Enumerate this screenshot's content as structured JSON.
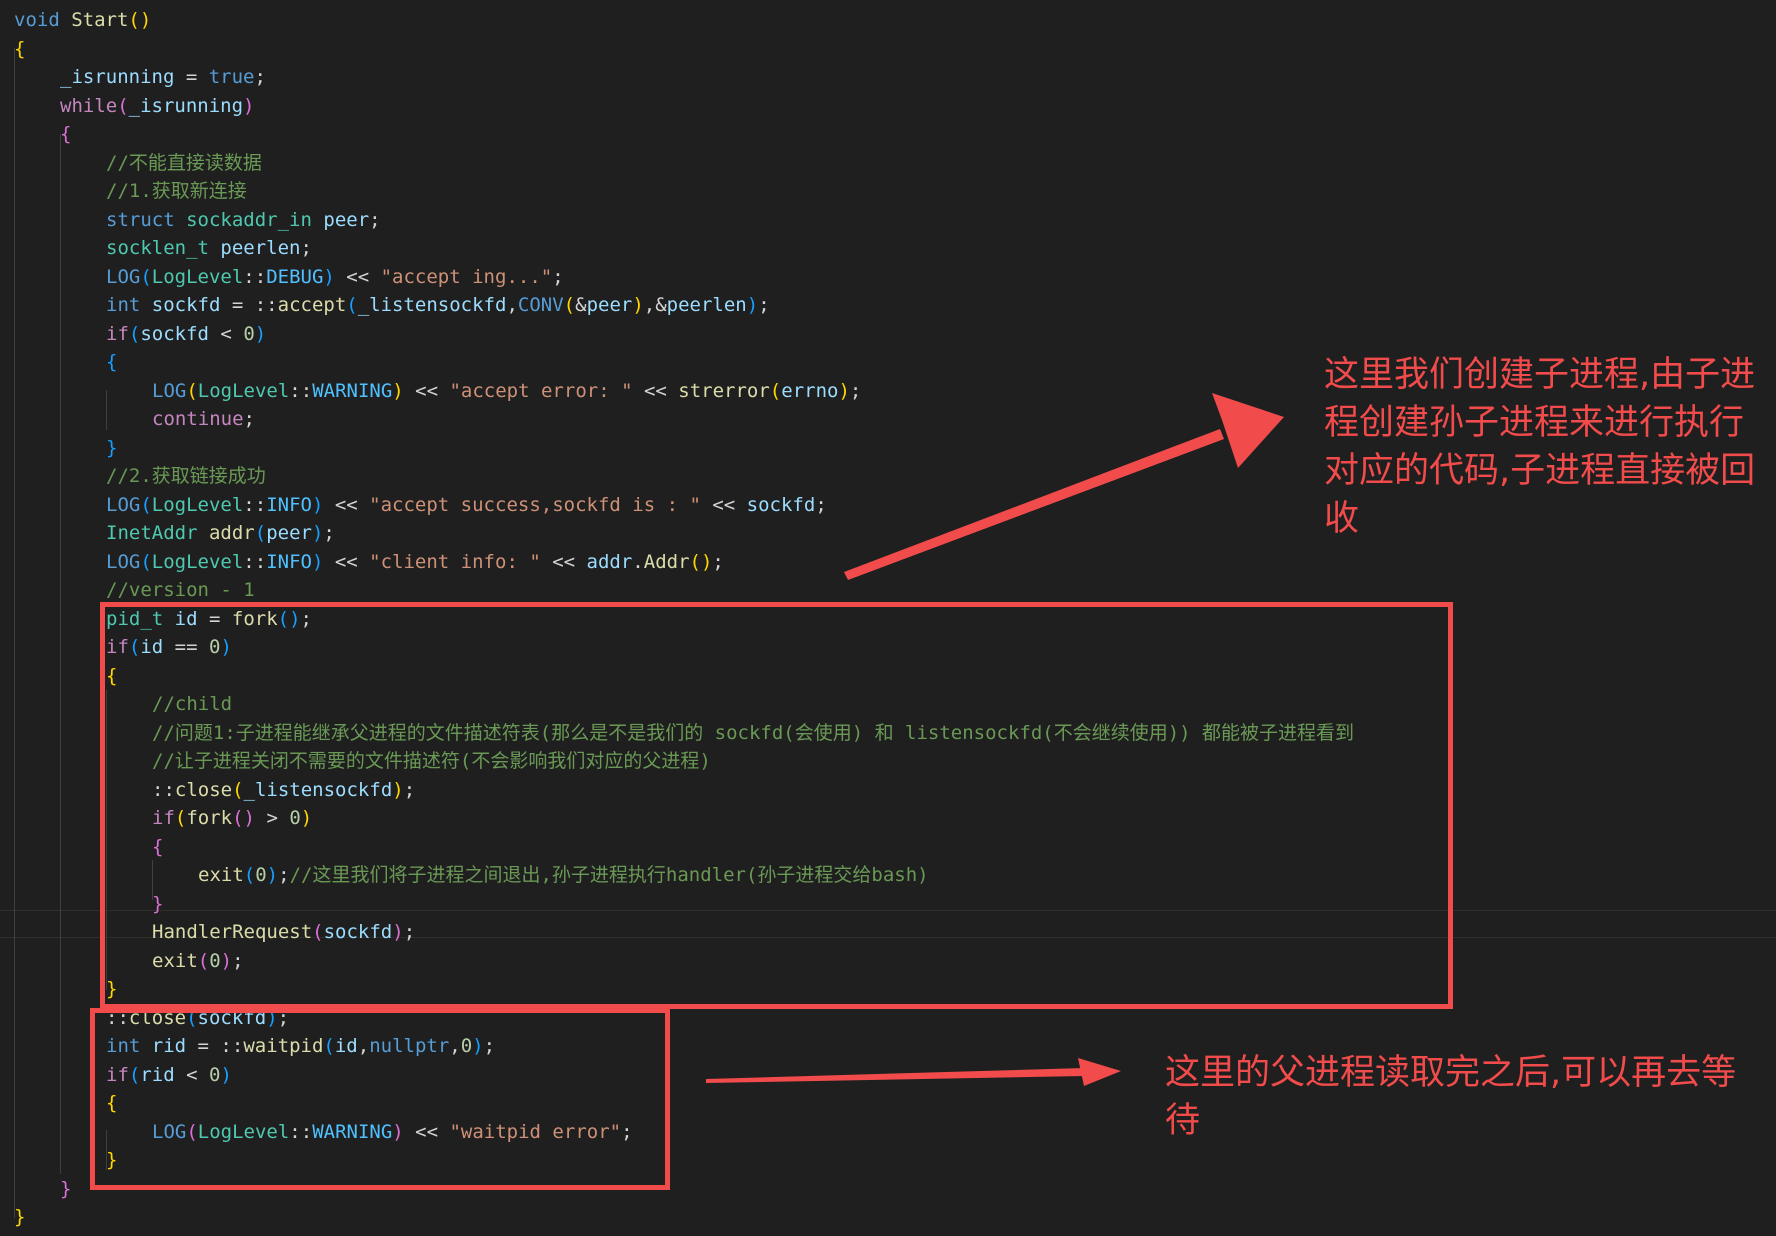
{
  "code_lines": [
    [
      [
        "void",
        "keyword"
      ],
      [
        " ",
        "punct"
      ],
      [
        "Start",
        "function"
      ],
      [
        "()",
        "bracket1"
      ]
    ],
    [
      [
        "{",
        "bracket1"
      ]
    ],
    [
      [
        "_isrunning",
        "variable"
      ],
      [
        " = ",
        "punct"
      ],
      [
        "true",
        "keyword"
      ],
      [
        ";",
        "punct"
      ]
    ],
    [
      [
        "while",
        "control"
      ],
      [
        "(",
        "bracket2"
      ],
      [
        "_isrunning",
        "variable"
      ],
      [
        ")",
        "bracket2"
      ]
    ],
    [
      [
        "{",
        "bracket2"
      ]
    ],
    [
      [
        "//不能直接读数据",
        "comment"
      ]
    ],
    [
      [
        "//1.获取新连接",
        "comment"
      ]
    ],
    [
      [
        "struct",
        "keyword"
      ],
      [
        " ",
        "punct"
      ],
      [
        "sockaddr_in",
        "type"
      ],
      [
        " ",
        "punct"
      ],
      [
        "peer",
        "variable"
      ],
      [
        ";",
        "punct"
      ]
    ],
    [
      [
        "socklen_t",
        "type"
      ],
      [
        " ",
        "punct"
      ],
      [
        "peerlen",
        "variable"
      ],
      [
        ";",
        "punct"
      ]
    ],
    [
      [
        "LOG",
        "macro"
      ],
      [
        "(",
        "bracket3"
      ],
      [
        "LogLevel",
        "type"
      ],
      [
        "::",
        "punct"
      ],
      [
        "DEBUG",
        "constant"
      ],
      [
        ")",
        "bracket3"
      ],
      [
        " << ",
        "punct"
      ],
      [
        "\"accept ing...\"",
        "string"
      ],
      [
        ";",
        "punct"
      ]
    ],
    [
      [
        "int",
        "keyword"
      ],
      [
        " ",
        "punct"
      ],
      [
        "sockfd",
        "variable"
      ],
      [
        " = ::",
        "punct"
      ],
      [
        "accept",
        "function"
      ],
      [
        "(",
        "bracket3"
      ],
      [
        "_listensockfd",
        "variable"
      ],
      [
        ",",
        "punct"
      ],
      [
        "CONV",
        "macro"
      ],
      [
        "(",
        "bracket1"
      ],
      [
        "&",
        "punct"
      ],
      [
        "peer",
        "variable"
      ],
      [
        ")",
        "bracket1"
      ],
      [
        ",&",
        "punct"
      ],
      [
        "peerlen",
        "variable"
      ],
      [
        ")",
        "bracket3"
      ],
      [
        ";",
        "punct"
      ]
    ],
    [
      [
        "if",
        "control"
      ],
      [
        "(",
        "bracket3"
      ],
      [
        "sockfd",
        "variable"
      ],
      [
        " < ",
        "punct"
      ],
      [
        "0",
        "number"
      ],
      [
        ")",
        "bracket3"
      ]
    ],
    [
      [
        "{",
        "bracket3"
      ]
    ],
    [
      [
        "LOG",
        "macro"
      ],
      [
        "(",
        "bracket1"
      ],
      [
        "LogLevel",
        "type"
      ],
      [
        "::",
        "punct"
      ],
      [
        "WARNING",
        "constant"
      ],
      [
        ")",
        "bracket1"
      ],
      [
        " << ",
        "punct"
      ],
      [
        "\"accept error: \"",
        "string"
      ],
      [
        " << ",
        "punct"
      ],
      [
        "strerror",
        "function"
      ],
      [
        "(",
        "bracket1"
      ],
      [
        "errno",
        "variable"
      ],
      [
        ")",
        "bracket1"
      ],
      [
        ";",
        "punct"
      ]
    ],
    [
      [
        "continue",
        "control"
      ],
      [
        ";",
        "punct"
      ]
    ],
    [
      [
        "}",
        "bracket3"
      ]
    ],
    [
      [
        "//2.获取链接成功",
        "comment"
      ]
    ],
    [
      [
        "LOG",
        "macro"
      ],
      [
        "(",
        "bracket3"
      ],
      [
        "LogLevel",
        "type"
      ],
      [
        "::",
        "punct"
      ],
      [
        "INFO",
        "constant"
      ],
      [
        ")",
        "bracket3"
      ],
      [
        " << ",
        "punct"
      ],
      [
        "\"accept success,sockfd is : \"",
        "string"
      ],
      [
        " << ",
        "punct"
      ],
      [
        "sockfd",
        "variable"
      ],
      [
        ";",
        "punct"
      ]
    ],
    [
      [
        "InetAddr",
        "type"
      ],
      [
        " ",
        "punct"
      ],
      [
        "addr",
        "function"
      ],
      [
        "(",
        "bracket3"
      ],
      [
        "peer",
        "variable"
      ],
      [
        ")",
        "bracket3"
      ],
      [
        ";",
        "punct"
      ]
    ],
    [
      [
        "LOG",
        "macro"
      ],
      [
        "(",
        "bracket3"
      ],
      [
        "LogLevel",
        "type"
      ],
      [
        "::",
        "punct"
      ],
      [
        "INFO",
        "constant"
      ],
      [
        ")",
        "bracket3"
      ],
      [
        " << ",
        "punct"
      ],
      [
        "\"client info: \"",
        "string"
      ],
      [
        " << ",
        "punct"
      ],
      [
        "addr",
        "variable"
      ],
      [
        ".",
        "punct"
      ],
      [
        "Addr",
        "function"
      ],
      [
        "()",
        "bracket1"
      ],
      [
        ";",
        "punct"
      ]
    ],
    [
      [
        "//version - 1",
        "comment"
      ]
    ],
    [
      [
        "pid_t",
        "type"
      ],
      [
        " ",
        "punct"
      ],
      [
        "id",
        "variable"
      ],
      [
        " = ",
        "punct"
      ],
      [
        "fork",
        "function"
      ],
      [
        "()",
        "bracket3"
      ],
      [
        ";",
        "punct"
      ]
    ],
    [
      [
        "if",
        "control"
      ],
      [
        "(",
        "bracket3"
      ],
      [
        "id",
        "variable"
      ],
      [
        " == ",
        "punct"
      ],
      [
        "0",
        "number"
      ],
      [
        ")",
        "bracket3"
      ]
    ],
    [
      [
        "{",
        "bracket1"
      ]
    ],
    [
      [
        "//child",
        "comment"
      ]
    ],
    [
      [
        "//问题1:子进程能继承父进程的文件描述符表(那么是不是我们的 sockfd(会使用) 和 listensockfd(不会继续使用)) 都能被子进程看到",
        "comment"
      ]
    ],
    [
      [
        "//让子进程关闭不需要的文件描述符(不会影响我们对应的父进程)",
        "comment"
      ]
    ],
    [
      [
        "::",
        "punct"
      ],
      [
        "close",
        "function"
      ],
      [
        "(",
        "bracket1"
      ],
      [
        "_listensockfd",
        "variable"
      ],
      [
        ")",
        "bracket1"
      ],
      [
        ";",
        "punct"
      ]
    ],
    [
      [
        "if",
        "control"
      ],
      [
        "(",
        "bracket1"
      ],
      [
        "fork",
        "function"
      ],
      [
        "()",
        "bracket2"
      ],
      [
        " > ",
        "punct"
      ],
      [
        "0",
        "number"
      ],
      [
        ")",
        "bracket1"
      ]
    ],
    [
      [
        "{",
        "bracket2"
      ]
    ],
    [
      [
        "exit",
        "function"
      ],
      [
        "(",
        "bracket3"
      ],
      [
        "0",
        "number"
      ],
      [
        ")",
        "bracket3"
      ],
      [
        ";",
        "punct"
      ],
      [
        "//这里我们将子进程之间退出,孙子进程执行handler(孙子进程交给bash)",
        "comment"
      ]
    ],
    [
      [
        "}",
        "bracket2"
      ]
    ],
    [
      [
        "HandlerRequest",
        "function"
      ],
      [
        "(",
        "bracket2"
      ],
      [
        "sockfd",
        "variable"
      ],
      [
        ")",
        "bracket2"
      ],
      [
        ";",
        "punct"
      ]
    ],
    [
      [
        "exit",
        "function"
      ],
      [
        "(",
        "bracket2"
      ],
      [
        "0",
        "number"
      ],
      [
        ")",
        "bracket2"
      ],
      [
        ";",
        "punct"
      ]
    ],
    [
      [
        "}",
        "bracket1"
      ]
    ],
    [
      [
        "::",
        "punct"
      ],
      [
        "close",
        "function"
      ],
      [
        "(",
        "bracket3"
      ],
      [
        "sockfd",
        "variable"
      ],
      [
        ")",
        "bracket3"
      ],
      [
        ";",
        "punct"
      ]
    ],
    [
      [
        "int",
        "keyword"
      ],
      [
        " ",
        "punct"
      ],
      [
        "rid",
        "variable"
      ],
      [
        " = ::",
        "punct"
      ],
      [
        "waitpid",
        "function"
      ],
      [
        "(",
        "bracket3"
      ],
      [
        "id",
        "variable"
      ],
      [
        ",",
        "punct"
      ],
      [
        "nullptr",
        "keyword"
      ],
      [
        ",",
        "punct"
      ],
      [
        "0",
        "number"
      ],
      [
        ")",
        "bracket3"
      ],
      [
        ";",
        "punct"
      ]
    ],
    [
      [
        "if",
        "control"
      ],
      [
        "(",
        "bracket3"
      ],
      [
        "rid",
        "variable"
      ],
      [
        " < ",
        "punct"
      ],
      [
        "0",
        "number"
      ],
      [
        ")",
        "bracket3"
      ]
    ],
    [
      [
        "{",
        "bracket1"
      ]
    ],
    [
      [
        "LOG",
        "macro"
      ],
      [
        "(",
        "bracket2"
      ],
      [
        "LogLevel",
        "type"
      ],
      [
        "::",
        "punct"
      ],
      [
        "WARNING",
        "constant"
      ],
      [
        ")",
        "bracket2"
      ],
      [
        " << ",
        "punct"
      ],
      [
        "\"waitpid error\"",
        "string"
      ],
      [
        ";",
        "punct"
      ]
    ],
    [
      [
        "}",
        "bracket1"
      ]
    ],
    [
      [
        "}",
        "bracket2"
      ]
    ],
    [
      [
        "}",
        "bracket1"
      ]
    ]
  ],
  "annotations": {
    "note_1": "这里我们创建子进程,由子进程创建孙子进程来进行执行对应的代码,子进程直接被回收",
    "note_2": "这里的父进程读取完之后,可以再去等待"
  },
  "colors": {
    "editor_background": "#1f1f1f",
    "annotation_red": "#f24b4b",
    "keyword": "#569cd6",
    "control": "#c586c0",
    "function": "#dcdcaa",
    "variable": "#9cdcfe",
    "type": "#4ec9b0",
    "string": "#ce9178",
    "number": "#b5cea8",
    "comment": "#6a9955"
  }
}
